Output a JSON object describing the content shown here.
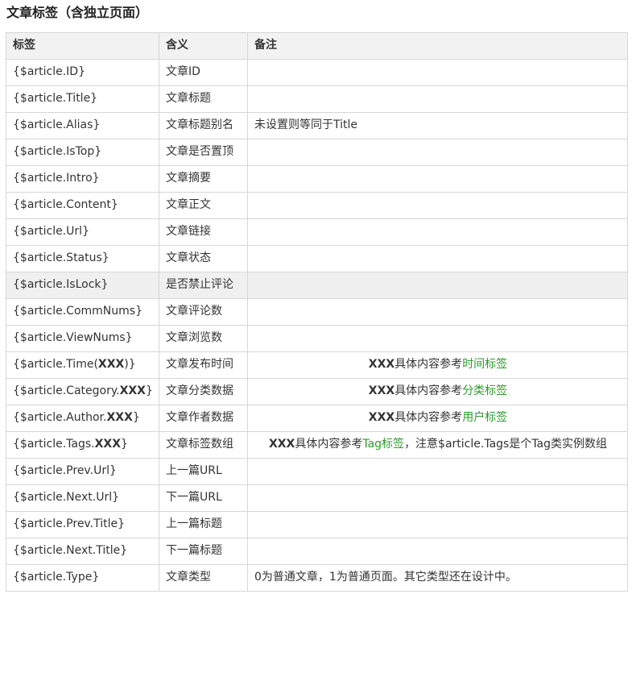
{
  "title": "文章标签（含独立页面）",
  "headers": [
    "标签",
    "含义",
    "备注"
  ],
  "colors": {
    "link_green": "#2e9a2e",
    "header_bg": "#f2f2f2",
    "highlight_row_bg": "#f0f0f0",
    "border": "#d6d6d6"
  },
  "rows": [
    {
      "tag": "{$article.ID}",
      "meaning": "文章ID",
      "note": ""
    },
    {
      "tag": "{$article.Title}",
      "meaning": "文章标题",
      "note": ""
    },
    {
      "tag": "{$article.Alias}",
      "meaning": "文章标题别名",
      "note": "未设置则等同于Title"
    },
    {
      "tag": "{$article.IsTop}",
      "meaning": "文章是否置顶",
      "note": ""
    },
    {
      "tag": "{$article.Intro}",
      "meaning": "文章摘要",
      "note": ""
    },
    {
      "tag": "{$article.Content}",
      "meaning": "文章正文",
      "note": ""
    },
    {
      "tag": "{$article.Url}",
      "meaning": "文章链接",
      "note": ""
    },
    {
      "tag": "{$article.Status}",
      "meaning": "文章状态",
      "note": ""
    },
    {
      "tag": "{$article.IsLock}",
      "meaning": "是否禁止评论",
      "note": ""
    },
    {
      "tag": "{$article.CommNums}",
      "meaning": "文章评论数",
      "note": ""
    },
    {
      "tag": "{$article.ViewNums}",
      "meaning": "文章浏览数",
      "note": ""
    },
    {
      "tag_pre": "{$article.Time(",
      "tag_bold": "XXX",
      "tag_post": ")}",
      "meaning": "文章发布时间",
      "note_bold": "XXX",
      "note_text": "具体内容参考",
      "note_link": "时间标签",
      "note_tail": ""
    },
    {
      "tag_pre": "{$article.Category.",
      "tag_bold": "XXX",
      "tag_post": "}",
      "meaning": "文章分类数据",
      "note_bold": "XXX",
      "note_text": "具体内容参考",
      "note_link": "分类标签",
      "note_tail": ""
    },
    {
      "tag_pre": "{$article.Author.",
      "tag_bold": "XXX",
      "tag_post": "}",
      "meaning": "文章作者数据",
      "note_bold": "XXX",
      "note_text": "具体内容参考",
      "note_link": "用户标签",
      "note_tail": ""
    },
    {
      "tag_pre": "{$article.Tags.",
      "tag_bold": "XXX",
      "tag_post": "}",
      "meaning": "文章标签数组",
      "note_bold": "XXX",
      "note_text": "具体内容参考",
      "note_link": "Tag标签",
      "note_tail": "，注意$article.Tags是个Tag类实例数组"
    },
    {
      "tag": "{$article.Prev.Url}",
      "meaning": "上一篇URL",
      "note": ""
    },
    {
      "tag": "{$article.Next.Url}",
      "meaning": "下一篇URL",
      "note": ""
    },
    {
      "tag": "{$article.Prev.Title}",
      "meaning": "上一篇标题",
      "note": ""
    },
    {
      "tag": "{$article.Next.Title}",
      "meaning": "下一篇标题",
      "note": ""
    },
    {
      "tag": "{$article.Type}",
      "meaning": "文章类型",
      "note": "0为普通文章，1为普通页面。其它类型还在设计中。"
    }
  ]
}
